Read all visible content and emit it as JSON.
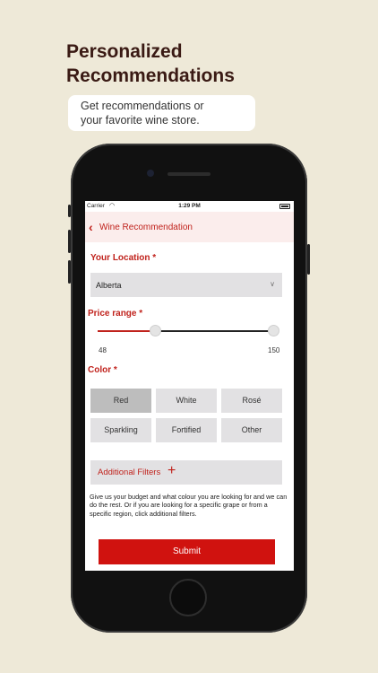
{
  "promo": {
    "headline_line1": "Personalized",
    "headline_line2": "Recommendations",
    "subtitle_line1": "Get recommendations or",
    "subtitle_line2": "your favorite wine store."
  },
  "status_bar": {
    "carrier": "Carrier",
    "time": "1:29 PM"
  },
  "nav": {
    "back_icon": "chevron-left-icon",
    "title": "Wine Recommendation"
  },
  "form": {
    "location_label": "Your Location *",
    "location_value": "Alberta",
    "price_label": "Price range *",
    "price_min": "48",
    "price_max": "150",
    "color_label": "Color *",
    "colors": [
      "Red",
      "White",
      "Rosé",
      "Sparkling",
      "Fortified",
      "Other"
    ],
    "selected_color": "Red",
    "additional_filters": "Additional Filters",
    "help_text": "Give us your budget and what colour you are looking for and we can do the rest. Or if you are looking for a specific grape or from a specific region, click additional filters.",
    "submit": "Submit"
  },
  "colors": {
    "accent": "#C0221C",
    "submit_bg": "#D0120F",
    "background": "#EEE9D8",
    "headline": "#3A1A14"
  }
}
